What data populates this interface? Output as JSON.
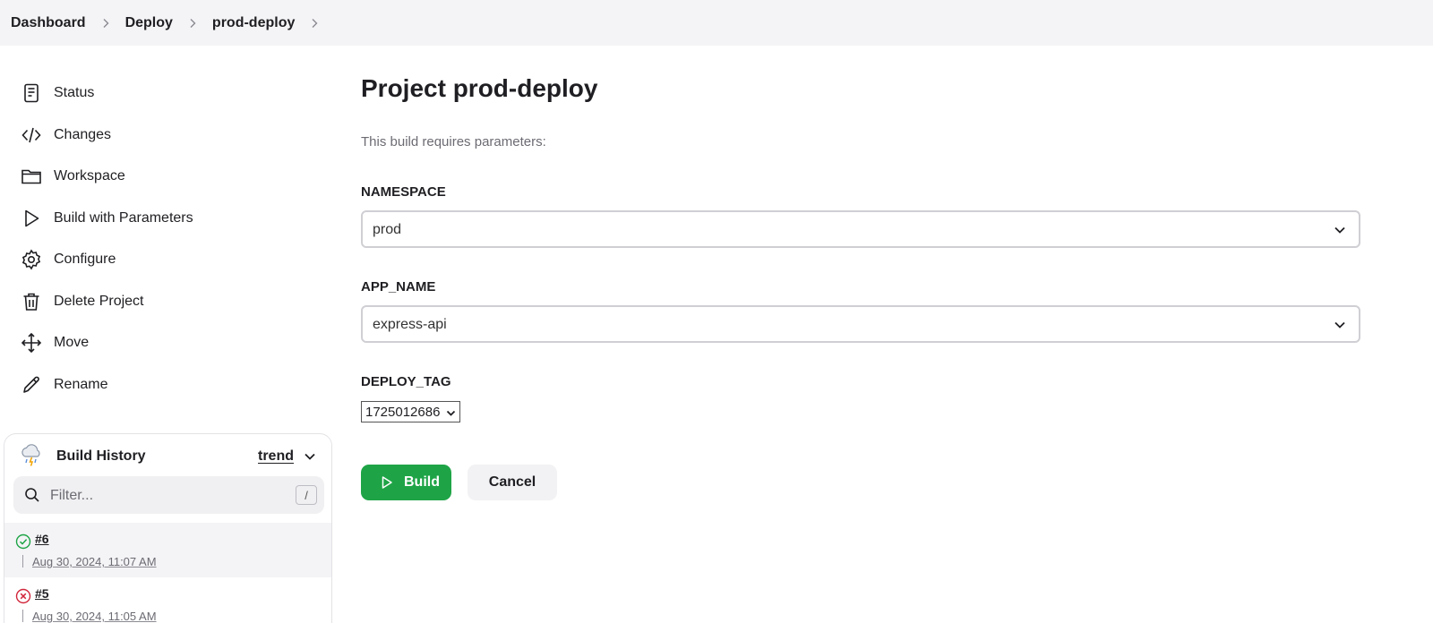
{
  "breadcrumb": {
    "items": [
      "Dashboard",
      "Deploy",
      "prod-deploy"
    ]
  },
  "sidebar": {
    "items": [
      {
        "label": "Status",
        "icon": "document-icon"
      },
      {
        "label": "Changes",
        "icon": "code-icon"
      },
      {
        "label": "Workspace",
        "icon": "folder-icon"
      },
      {
        "label": "Build with Parameters",
        "icon": "play-icon"
      },
      {
        "label": "Configure",
        "icon": "gear-icon"
      },
      {
        "label": "Delete Project",
        "icon": "trash-icon"
      },
      {
        "label": "Move",
        "icon": "move-icon"
      },
      {
        "label": "Rename",
        "icon": "pencil-icon"
      }
    ]
  },
  "build_history": {
    "title": "Build History",
    "trend_label": "trend",
    "filter_placeholder": "Filter...",
    "filter_shortcut": "/",
    "builds": [
      {
        "number": "#6",
        "date": "Aug 30, 2024, 11:07 AM",
        "status": "success"
      },
      {
        "number": "#5",
        "date": "Aug 30, 2024, 11:05 AM",
        "status": "failed"
      }
    ]
  },
  "main": {
    "title": "Project prod-deploy",
    "requires_text": "This build requires parameters:",
    "params": [
      {
        "name": "NAMESPACE",
        "value": "prod"
      },
      {
        "name": "APP_NAME",
        "value": "express-api"
      },
      {
        "name": "DEPLOY_TAG",
        "value": "1725012686"
      }
    ],
    "build_label": "Build",
    "cancel_label": "Cancel"
  },
  "colors": {
    "accent_green": "#1ea446",
    "success": "#1ea446",
    "failure": "#d1263b"
  }
}
